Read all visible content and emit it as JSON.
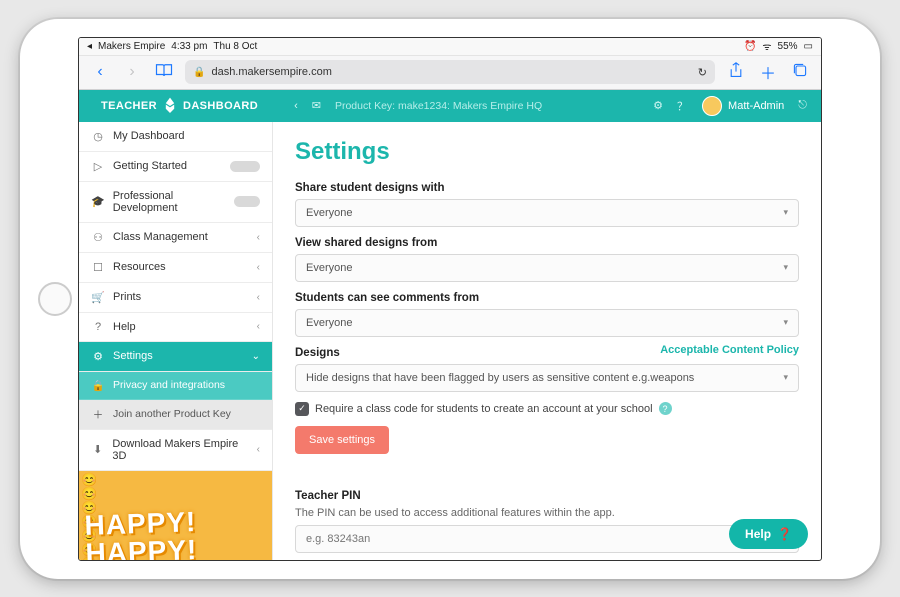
{
  "statusbar": {
    "app_name": "Makers Empire",
    "time": "4:33 pm",
    "date": "Thu 8 Oct",
    "battery": "55%"
  },
  "browser": {
    "url": "dash.makersempire.com"
  },
  "brand": {
    "left": "TEACHER",
    "right": "DASHBOARD"
  },
  "header": {
    "product_key_line": "Product Key: make1234: Makers Empire HQ",
    "user_name": "Matt-Admin"
  },
  "sidebar": {
    "items": [
      {
        "label": "My Dashboard",
        "expandable": false,
        "pill": false
      },
      {
        "label": "Getting Started",
        "expandable": false,
        "pill": true
      },
      {
        "label": "Professional Development",
        "expandable": false,
        "pill": true
      },
      {
        "label": "Class Management",
        "expandable": true,
        "pill": false
      },
      {
        "label": "Resources",
        "expandable": true,
        "pill": false
      },
      {
        "label": "Prints",
        "expandable": true,
        "pill": false
      },
      {
        "label": "Help",
        "expandable": true,
        "pill": false
      },
      {
        "label": "Settings",
        "expandable": true,
        "pill": false,
        "active": true
      }
    ],
    "sub": [
      {
        "label": "Privacy and integrations"
      },
      {
        "label": "Join another Product Key"
      }
    ],
    "download": "Download Makers Empire 3D",
    "promo": "HAPPY!"
  },
  "settings": {
    "title": "Settings",
    "share_label": "Share student designs with",
    "share_value": "Everyone",
    "view_label": "View shared designs from",
    "view_value": "Everyone",
    "comments_label": "Students can see comments from",
    "comments_value": "Everyone",
    "designs_label": "Designs",
    "policy_link": "Acceptable Content Policy",
    "designs_value": "Hide designs that have been flagged by users as sensitive content e.g.weapons",
    "checkbox_label": "Require a class code for students to create an account at your school",
    "save_button": "Save settings",
    "pin_label": "Teacher PIN",
    "pin_help": "The PIN can be used to access additional features within the app.",
    "pin_placeholder": "e.g. 83243an"
  },
  "fab": {
    "label": "Help"
  }
}
